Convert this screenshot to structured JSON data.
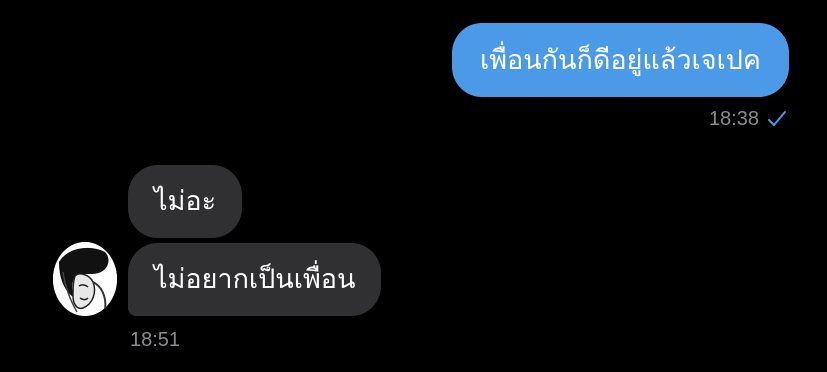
{
  "colors": {
    "background": "#000000",
    "outgoing_bubble": "#4a9ae8",
    "incoming_bubble": "#303033",
    "timestamp": "#8a8a8f",
    "read_check": "#4a9ae8"
  },
  "messages": [
    {
      "direction": "outgoing",
      "text": "เพื่อนกันก็ดีอยู่แล้วเจเปค",
      "time": "18:38",
      "status_icon": "check-icon"
    },
    {
      "direction": "incoming",
      "text": "ไม่อะ"
    },
    {
      "direction": "incoming",
      "text": "ไม่อยากเป็นเพื่อน",
      "time": "18:51",
      "avatar_icon": "avatar"
    }
  ]
}
